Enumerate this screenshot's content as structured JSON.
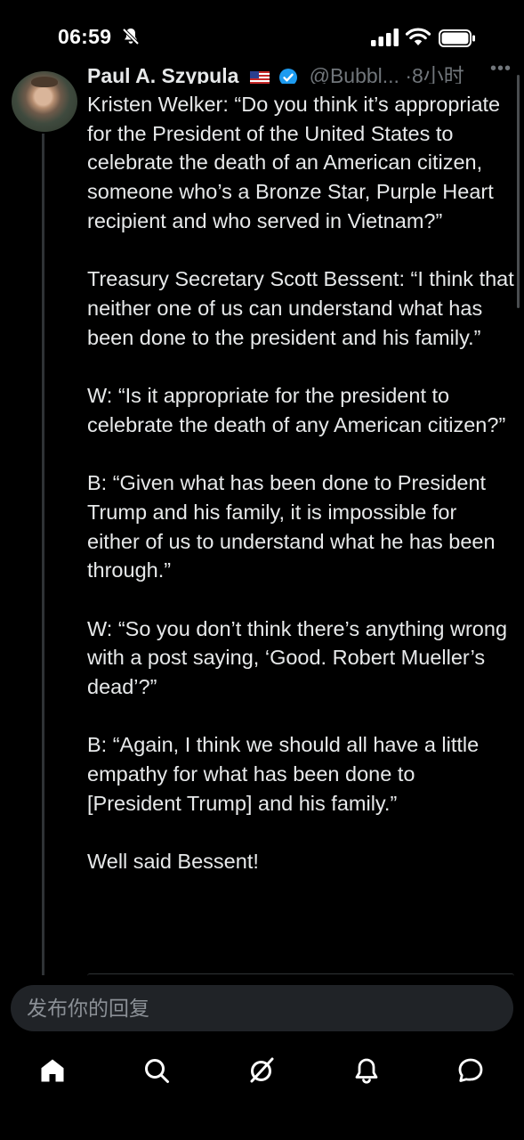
{
  "status_bar": {
    "time": "06:59"
  },
  "tweet": {
    "author_name": "Paul A. Szypula",
    "author_handle": "@Bubbl...",
    "time_ago": "·8小时",
    "paragraphs": [
      "Kristen Welker: “Do you think it’s appropriate for the President of the United States to celebrate the death of an American citizen, someone who’s a Bronze Star, Purple Heart recipient and who served in Vietnam?”",
      "Treasury Secretary Scott Bessent: “I think that neither one of us can understand what has been done to the president and his family.”",
      "W: “Is it appropriate for the president to celebrate the death of any American citizen?”",
      "B: “Given what has been done to President Trump and his family, it is impossible for either of us to understand what he has been through.”",
      "W: “So you don’t think there’s anything wrong with a post saying, ‘Good. Robert Mueller’s dead’?”",
      "B: “Again, I think we should all have a little empathy for what has been done to [President Trump] and his family.”",
      "Well said Bessent!"
    ]
  },
  "reply": {
    "placeholder": "发布你的回复"
  },
  "nav": [
    {
      "icon": "home-icon"
    },
    {
      "icon": "search-icon"
    },
    {
      "icon": "grok-icon"
    },
    {
      "icon": "notifications-icon"
    },
    {
      "icon": "messages-icon"
    }
  ],
  "colors": {
    "background": "#000000",
    "text": "#e7e9ea",
    "muted": "#71767b",
    "verified": "#1d9bf0",
    "reply_box": "#202327"
  }
}
